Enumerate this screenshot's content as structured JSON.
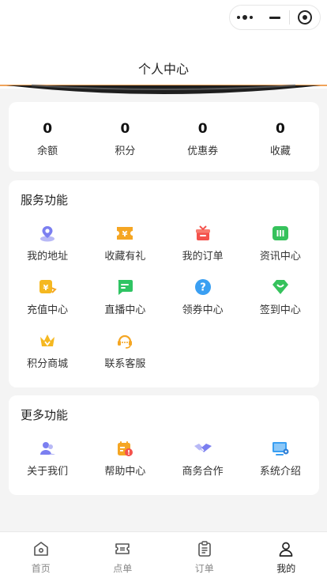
{
  "header": {
    "title": "个人中心"
  },
  "stats": [
    {
      "value": "0",
      "label": "余额"
    },
    {
      "value": "0",
      "label": "积分"
    },
    {
      "value": "0",
      "label": "优惠券"
    },
    {
      "value": "0",
      "label": "收藏"
    }
  ],
  "services": {
    "title": "服务功能",
    "items": [
      {
        "label": "我的地址",
        "icon": "location-icon",
        "color": "#7b7ff0"
      },
      {
        "label": "收藏有礼",
        "icon": "coupon-icon",
        "color": "#f5a623"
      },
      {
        "label": "我的订单",
        "icon": "gift-icon",
        "color": "#f4524c"
      },
      {
        "label": "资讯中心",
        "icon": "news-icon",
        "color": "#36c25c"
      },
      {
        "label": "充值中心",
        "icon": "recharge-icon",
        "color": "#f5b820"
      },
      {
        "label": "直播中心",
        "icon": "chat-icon",
        "color": "#2fc463"
      },
      {
        "label": "领券中心",
        "icon": "help-icon",
        "color": "#3a9ff2"
      },
      {
        "label": "签到中心",
        "icon": "checkin-icon",
        "color": "#36c25c"
      },
      {
        "label": "积分商城",
        "icon": "crown-icon",
        "color": "#f5b820"
      },
      {
        "label": "联系客服",
        "icon": "headset-icon",
        "color": "#f5a623"
      }
    ]
  },
  "more": {
    "title": "更多功能",
    "items": [
      {
        "label": "关于我们",
        "icon": "team-icon",
        "color": "#7b7ff0"
      },
      {
        "label": "帮助中心",
        "icon": "calendar-alert-icon",
        "color": "#f5a623"
      },
      {
        "label": "商务合作",
        "icon": "handshake-icon",
        "color": "#7b7ff0"
      },
      {
        "label": "系统介绍",
        "icon": "monitor-icon",
        "color": "#3a9ff2"
      }
    ]
  },
  "tabbar": [
    {
      "label": "首页",
      "icon": "home-icon",
      "active": false
    },
    {
      "label": "点单",
      "icon": "ticket-icon",
      "active": false
    },
    {
      "label": "订单",
      "icon": "clipboard-icon",
      "active": false
    },
    {
      "label": "我的",
      "icon": "user-icon",
      "active": true
    }
  ]
}
